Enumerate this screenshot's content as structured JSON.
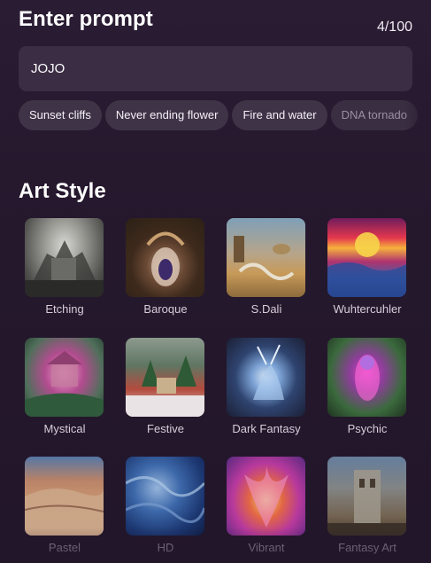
{
  "header": {
    "title": "Enter prompt",
    "counter": "4/100"
  },
  "prompt": {
    "value": "JOJO"
  },
  "suggestions": [
    "Sunset cliffs",
    "Never ending flower",
    "Fire and water",
    "DNA tornado"
  ],
  "art_style": {
    "title": "Art Style",
    "styles": [
      {
        "label": "Etching",
        "icon": "etching-thumbnail"
      },
      {
        "label": "Baroque",
        "icon": "baroque-thumbnail"
      },
      {
        "label": "S.Dali",
        "icon": "dali-thumbnail"
      },
      {
        "label": "Wuhtercuhler",
        "icon": "wuhtercuhler-thumbnail"
      },
      {
        "label": "Mystical",
        "icon": "mystical-thumbnail"
      },
      {
        "label": "Festive",
        "icon": "festive-thumbnail"
      },
      {
        "label": "Dark Fantasy",
        "icon": "dark-fantasy-thumbnail"
      },
      {
        "label": "Psychic",
        "icon": "psychic-thumbnail"
      },
      {
        "label": "Pastel",
        "icon": "pastel-thumbnail"
      },
      {
        "label": "HD",
        "icon": "hd-thumbnail"
      },
      {
        "label": "Vibrant",
        "icon": "vibrant-thumbnail"
      },
      {
        "label": "Fantasy Art",
        "icon": "fantasy-art-thumbnail"
      }
    ]
  },
  "colors": {
    "background": "#271a30",
    "input_bg": "#3b2d44",
    "chip_bg": "#3f3347",
    "label_text": "#d6cdd9"
  }
}
